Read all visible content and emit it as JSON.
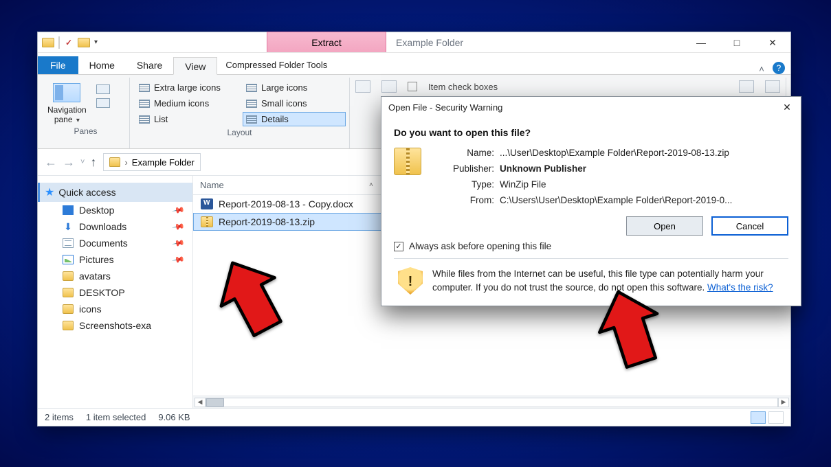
{
  "window": {
    "title": "Example Folder",
    "extract_tab": "Extract",
    "cft_label": "Compressed Folder Tools",
    "tabs": {
      "file": "File",
      "home": "Home",
      "share": "Share",
      "view": "View"
    }
  },
  "ribbon": {
    "panes": {
      "navigation": "Navigation\npane",
      "group_label": "Panes"
    },
    "layout": {
      "items": [
        "Extra large icons",
        "Large icons",
        "Medium icons",
        "Small icons",
        "List",
        "Details"
      ],
      "selected": "Details",
      "group_label": "Layout"
    },
    "extras": {
      "item_check_boxes": "Item check boxes"
    }
  },
  "address": {
    "crumb": "Example Folder"
  },
  "sidebar": {
    "quick_access": "Quick access",
    "items": [
      {
        "label": "Desktop",
        "icon": "desktop",
        "pinned": true
      },
      {
        "label": "Downloads",
        "icon": "download",
        "pinned": true
      },
      {
        "label": "Documents",
        "icon": "docs",
        "pinned": true
      },
      {
        "label": "Pictures",
        "icon": "pics",
        "pinned": true
      },
      {
        "label": "avatars",
        "icon": "folder",
        "pinned": false
      },
      {
        "label": "DESKTOP",
        "icon": "folder",
        "pinned": false
      },
      {
        "label": "icons",
        "icon": "folder",
        "pinned": false
      },
      {
        "label": "Screenshots-exa",
        "icon": "folder",
        "pinned": false
      }
    ]
  },
  "filelist": {
    "col_name": "Name",
    "rows": [
      {
        "name": "Report-2019-08-13 - Copy.docx",
        "icon": "docx",
        "selected": false
      },
      {
        "name": "Report-2019-08-13.zip",
        "icon": "zip",
        "selected": true
      }
    ]
  },
  "status": {
    "count": "2 items",
    "selection": "1 item selected",
    "size": "9.06 KB"
  },
  "dialog": {
    "title": "Open File - Security Warning",
    "question": "Do you want to open this file?",
    "name_label": "Name:",
    "name_val": "...\\User\\Desktop\\Example Folder\\Report-2019-08-13.zip",
    "publisher_label": "Publisher:",
    "publisher_val": "Unknown Publisher",
    "type_label": "Type:",
    "type_val": "WinZip File",
    "from_label": "From:",
    "from_val": "C:\\Users\\User\\Desktop\\Example Folder\\Report-2019-0...",
    "open": "Open",
    "cancel": "Cancel",
    "ask_checkbox": "Always ask before opening this file",
    "ask_checked": true,
    "warn_text": "While files from the Internet can be useful, this file type can potentially harm your computer. If you do not trust the source, do not open this software. ",
    "risk_link": "What's the risk?"
  }
}
